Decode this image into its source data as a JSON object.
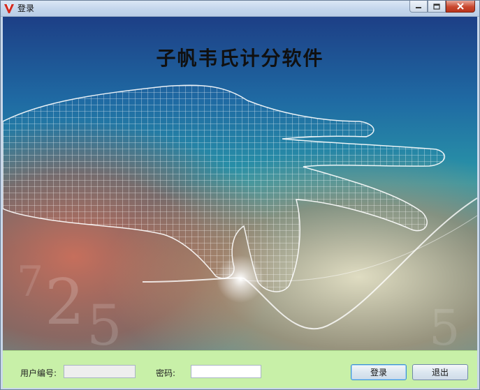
{
  "window": {
    "title": "登录",
    "accent": "#c4d6ec",
    "close_color": "#c9482f"
  },
  "banner": {
    "title": "子帆韦氏计分软件"
  },
  "form": {
    "username_label": "用户编号:",
    "username_value": "",
    "password_label": "密码:",
    "password_value": "",
    "login_label": "登录",
    "exit_label": "退出",
    "background": "#c8f0a8"
  },
  "icons": {
    "app_logo": "red-v-logo-icon",
    "minimize": "minimize-icon",
    "maximize": "maximize-icon",
    "close": "close-icon"
  }
}
